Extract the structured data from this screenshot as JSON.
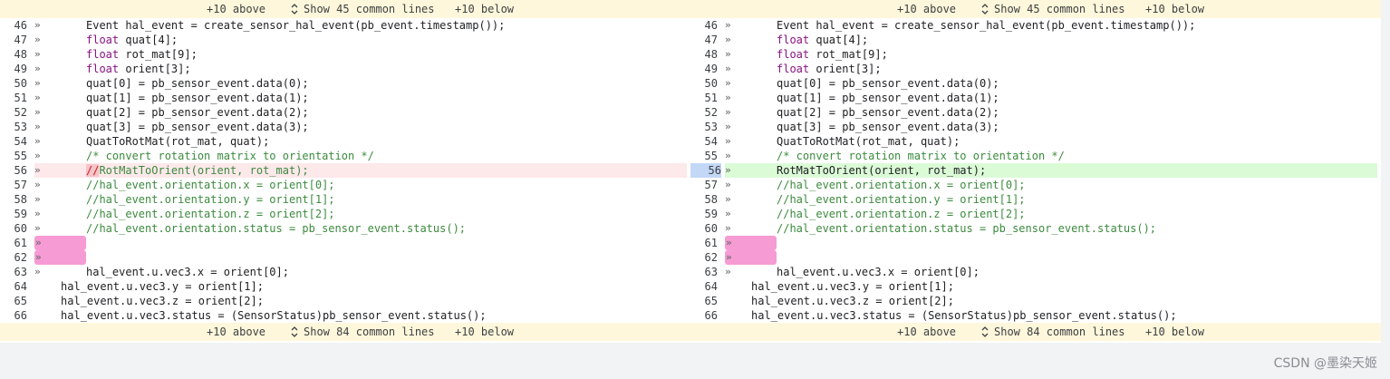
{
  "skip_top": {
    "above": "+10 above",
    "common": "Show 45 common lines",
    "below": "+10 below"
  },
  "skip_bottom": {
    "above": "+10 above",
    "common": "Show 84 common lines",
    "below": "+10 below"
  },
  "tab_glyph": "»",
  "colors": {
    "deleted_line_bg": "#fde8ea",
    "added_line_bg": "#dbfbd7",
    "whitespace_marker": "#f69bd3",
    "skip_bar_bg": "#fff7db"
  },
  "left_lines": [
    {
      "num": "46",
      "tab": "»",
      "code": "Event hal_event = create_sensor_hal_event(pb_event.timestamp());"
    },
    {
      "num": "47",
      "tab": "»",
      "kw": "float",
      "rest": " quat[4];"
    },
    {
      "num": "48",
      "tab": "»",
      "kw": "float",
      "rest": " rot_mat[9];"
    },
    {
      "num": "49",
      "tab": "»",
      "kw": "float",
      "rest": " orient[3];"
    },
    {
      "num": "50",
      "tab": "»",
      "code": "quat[0] = pb_sensor_event.data(0);"
    },
    {
      "num": "51",
      "tab": "»",
      "code": "quat[1] = pb_sensor_event.data(1);"
    },
    {
      "num": "52",
      "tab": "»",
      "code": "quat[2] = pb_sensor_event.data(2);"
    },
    {
      "num": "53",
      "tab": "»",
      "code": "quat[3] = pb_sensor_event.data(3);"
    },
    {
      "num": "54",
      "tab": "»",
      "code": "QuatToRotMat(rot_mat, quat);"
    },
    {
      "num": "55",
      "tab": "»",
      "comment": "/* convert rotation matrix to orientation */"
    },
    {
      "num": "56",
      "tab": "»",
      "deleted": "//",
      "code": "RotMatToOrient(orient, rot_mat);"
    },
    {
      "num": "57",
      "tab": "»",
      "comment": "//hal_event.orientation.x = orient[0];"
    },
    {
      "num": "58",
      "tab": "»",
      "comment": "//hal_event.orientation.y = orient[1];"
    },
    {
      "num": "59",
      "tab": "»",
      "comment": "//hal_event.orientation.z = orient[2];"
    },
    {
      "num": "60",
      "tab": "»",
      "comment": "//hal_event.orientation.status = pb_sensor_event.status();"
    },
    {
      "num": "61",
      "tab": "»",
      "ws": true
    },
    {
      "num": "62",
      "tab": "»",
      "ws": true
    },
    {
      "num": "63",
      "tab": "»",
      "code": "hal_event.u.vec3.x = orient[0];"
    },
    {
      "num": "64",
      "code": "hal_event.u.vec3.y = orient[1];",
      "wrap": true
    },
    {
      "num": "65",
      "code": "hal_event.u.vec3.z = orient[2];",
      "wrap": true
    },
    {
      "num": "66",
      "code": "hal_event.u.vec3.status = (SensorStatus)pb_sensor_event.status();",
      "wrap": true
    }
  ],
  "right_lines": [
    {
      "num": "46",
      "tab": "»",
      "code": "Event hal_event = create_sensor_hal_event(pb_event.timestamp());"
    },
    {
      "num": "47",
      "tab": "»",
      "kw": "float",
      "rest": " quat[4];"
    },
    {
      "num": "48",
      "tab": "»",
      "kw": "float",
      "rest": " rot_mat[9];"
    },
    {
      "num": "49",
      "tab": "»",
      "kw": "float",
      "rest": " orient[3];"
    },
    {
      "num": "50",
      "tab": "»",
      "code": "quat[0] = pb_sensor_event.data(0);"
    },
    {
      "num": "51",
      "tab": "»",
      "code": "quat[1] = pb_sensor_event.data(1);"
    },
    {
      "num": "52",
      "tab": "»",
      "code": "quat[2] = pb_sensor_event.data(2);"
    },
    {
      "num": "53",
      "tab": "»",
      "code": "quat[3] = pb_sensor_event.data(3);"
    },
    {
      "num": "54",
      "tab": "»",
      "code": "QuatToRotMat(rot_mat, quat);"
    },
    {
      "num": "55",
      "tab": "»",
      "comment": "/* convert rotation matrix to orientation */"
    },
    {
      "num": "56",
      "tab": "»",
      "added": true,
      "code": "RotMatToOrient(orient, rot_mat);"
    },
    {
      "num": "57",
      "tab": "»",
      "comment": "//hal_event.orientation.x = orient[0];"
    },
    {
      "num": "58",
      "tab": "»",
      "comment": "//hal_event.orientation.y = orient[1];"
    },
    {
      "num": "59",
      "tab": "»",
      "comment": "//hal_event.orientation.z = orient[2];"
    },
    {
      "num": "60",
      "tab": "»",
      "comment": "//hal_event.orientation.status = pb_sensor_event.status();"
    },
    {
      "num": "61",
      "tab": "»",
      "ws": true
    },
    {
      "num": "62",
      "tab": "»",
      "ws": true
    },
    {
      "num": "63",
      "tab": "»",
      "code": "hal_event.u.vec3.x = orient[0];"
    },
    {
      "num": "64",
      "code": "hal_event.u.vec3.y = orient[1];",
      "wrap": true
    },
    {
      "num": "65",
      "code": "hal_event.u.vec3.z = orient[2];",
      "wrap": true
    },
    {
      "num": "66",
      "code": "hal_event.u.vec3.status = (SensorStatus)pb_sensor_event.status();",
      "wrap": true
    }
  ],
  "watermark": "CSDN @墨染天姬"
}
